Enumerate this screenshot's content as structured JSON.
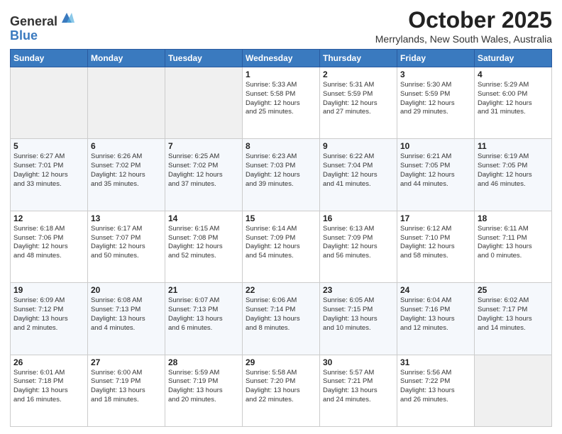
{
  "logo": {
    "general": "General",
    "blue": "Blue"
  },
  "title": "October 2025",
  "subtitle": "Merrylands, New South Wales, Australia",
  "headers": [
    "Sunday",
    "Monday",
    "Tuesday",
    "Wednesday",
    "Thursday",
    "Friday",
    "Saturday"
  ],
  "rows": [
    [
      {
        "day": "",
        "info": "",
        "empty": true
      },
      {
        "day": "",
        "info": "",
        "empty": true
      },
      {
        "day": "",
        "info": "",
        "empty": true
      },
      {
        "day": "1",
        "info": "Sunrise: 5:33 AM\nSunset: 5:58 PM\nDaylight: 12 hours\nand 25 minutes.",
        "empty": false
      },
      {
        "day": "2",
        "info": "Sunrise: 5:31 AM\nSunset: 5:59 PM\nDaylight: 12 hours\nand 27 minutes.",
        "empty": false
      },
      {
        "day": "3",
        "info": "Sunrise: 5:30 AM\nSunset: 5:59 PM\nDaylight: 12 hours\nand 29 minutes.",
        "empty": false
      },
      {
        "day": "4",
        "info": "Sunrise: 5:29 AM\nSunset: 6:00 PM\nDaylight: 12 hours\nand 31 minutes.",
        "empty": false
      }
    ],
    [
      {
        "day": "5",
        "info": "Sunrise: 6:27 AM\nSunset: 7:01 PM\nDaylight: 12 hours\nand 33 minutes.",
        "empty": false
      },
      {
        "day": "6",
        "info": "Sunrise: 6:26 AM\nSunset: 7:02 PM\nDaylight: 12 hours\nand 35 minutes.",
        "empty": false
      },
      {
        "day": "7",
        "info": "Sunrise: 6:25 AM\nSunset: 7:02 PM\nDaylight: 12 hours\nand 37 minutes.",
        "empty": false
      },
      {
        "day": "8",
        "info": "Sunrise: 6:23 AM\nSunset: 7:03 PM\nDaylight: 12 hours\nand 39 minutes.",
        "empty": false
      },
      {
        "day": "9",
        "info": "Sunrise: 6:22 AM\nSunset: 7:04 PM\nDaylight: 12 hours\nand 41 minutes.",
        "empty": false
      },
      {
        "day": "10",
        "info": "Sunrise: 6:21 AM\nSunset: 7:05 PM\nDaylight: 12 hours\nand 44 minutes.",
        "empty": false
      },
      {
        "day": "11",
        "info": "Sunrise: 6:19 AM\nSunset: 7:05 PM\nDaylight: 12 hours\nand 46 minutes.",
        "empty": false
      }
    ],
    [
      {
        "day": "12",
        "info": "Sunrise: 6:18 AM\nSunset: 7:06 PM\nDaylight: 12 hours\nand 48 minutes.",
        "empty": false
      },
      {
        "day": "13",
        "info": "Sunrise: 6:17 AM\nSunset: 7:07 PM\nDaylight: 12 hours\nand 50 minutes.",
        "empty": false
      },
      {
        "day": "14",
        "info": "Sunrise: 6:15 AM\nSunset: 7:08 PM\nDaylight: 12 hours\nand 52 minutes.",
        "empty": false
      },
      {
        "day": "15",
        "info": "Sunrise: 6:14 AM\nSunset: 7:09 PM\nDaylight: 12 hours\nand 54 minutes.",
        "empty": false
      },
      {
        "day": "16",
        "info": "Sunrise: 6:13 AM\nSunset: 7:09 PM\nDaylight: 12 hours\nand 56 minutes.",
        "empty": false
      },
      {
        "day": "17",
        "info": "Sunrise: 6:12 AM\nSunset: 7:10 PM\nDaylight: 12 hours\nand 58 minutes.",
        "empty": false
      },
      {
        "day": "18",
        "info": "Sunrise: 6:11 AM\nSunset: 7:11 PM\nDaylight: 13 hours\nand 0 minutes.",
        "empty": false
      }
    ],
    [
      {
        "day": "19",
        "info": "Sunrise: 6:09 AM\nSunset: 7:12 PM\nDaylight: 13 hours\nand 2 minutes.",
        "empty": false
      },
      {
        "day": "20",
        "info": "Sunrise: 6:08 AM\nSunset: 7:13 PM\nDaylight: 13 hours\nand 4 minutes.",
        "empty": false
      },
      {
        "day": "21",
        "info": "Sunrise: 6:07 AM\nSunset: 7:13 PM\nDaylight: 13 hours\nand 6 minutes.",
        "empty": false
      },
      {
        "day": "22",
        "info": "Sunrise: 6:06 AM\nSunset: 7:14 PM\nDaylight: 13 hours\nand 8 minutes.",
        "empty": false
      },
      {
        "day": "23",
        "info": "Sunrise: 6:05 AM\nSunset: 7:15 PM\nDaylight: 13 hours\nand 10 minutes.",
        "empty": false
      },
      {
        "day": "24",
        "info": "Sunrise: 6:04 AM\nSunset: 7:16 PM\nDaylight: 13 hours\nand 12 minutes.",
        "empty": false
      },
      {
        "day": "25",
        "info": "Sunrise: 6:02 AM\nSunset: 7:17 PM\nDaylight: 13 hours\nand 14 minutes.",
        "empty": false
      }
    ],
    [
      {
        "day": "26",
        "info": "Sunrise: 6:01 AM\nSunset: 7:18 PM\nDaylight: 13 hours\nand 16 minutes.",
        "empty": false
      },
      {
        "day": "27",
        "info": "Sunrise: 6:00 AM\nSunset: 7:19 PM\nDaylight: 13 hours\nand 18 minutes.",
        "empty": false
      },
      {
        "day": "28",
        "info": "Sunrise: 5:59 AM\nSunset: 7:19 PM\nDaylight: 13 hours\nand 20 minutes.",
        "empty": false
      },
      {
        "day": "29",
        "info": "Sunrise: 5:58 AM\nSunset: 7:20 PM\nDaylight: 13 hours\nand 22 minutes.",
        "empty": false
      },
      {
        "day": "30",
        "info": "Sunrise: 5:57 AM\nSunset: 7:21 PM\nDaylight: 13 hours\nand 24 minutes.",
        "empty": false
      },
      {
        "day": "31",
        "info": "Sunrise: 5:56 AM\nSunset: 7:22 PM\nDaylight: 13 hours\nand 26 minutes.",
        "empty": false
      },
      {
        "day": "",
        "info": "",
        "empty": true
      }
    ]
  ]
}
